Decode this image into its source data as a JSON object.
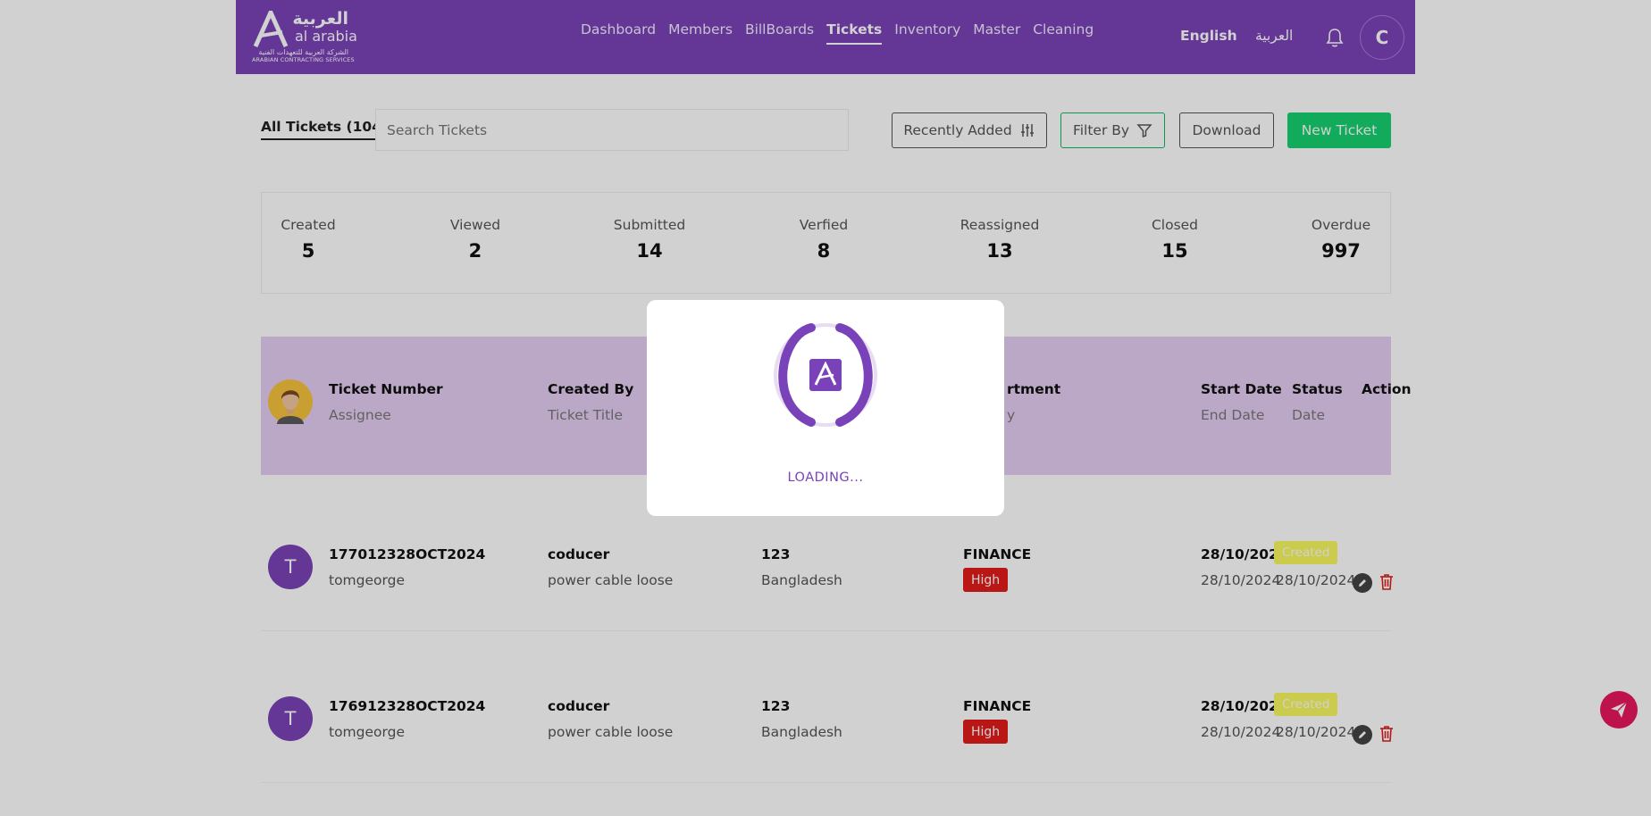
{
  "brand": {
    "arabic_name": "العربية",
    "english_name": "al arabia",
    "arabic_subtitle": "الشركة العربية للتعهدات الفنية",
    "english_subtitle": "ARABIAN CONTRACTING SERVICES"
  },
  "nav": {
    "items": [
      "Dashboard",
      "Members",
      "BillBoards",
      "Tickets",
      "Inventory",
      "Master",
      "Cleaning"
    ],
    "active": "Tickets"
  },
  "header": {
    "lang_en": "English",
    "lang_ar": "العربية",
    "user_initial": "C"
  },
  "toolbar": {
    "all_tickets": "All Tickets (1041)",
    "search_placeholder": "Search Tickets",
    "sort_label": "Recently Added",
    "filter_label": "Filter By",
    "download_label": "Download",
    "new_ticket_label": "New Ticket"
  },
  "stats": [
    {
      "label": "Created",
      "value": "5"
    },
    {
      "label": "Viewed",
      "value": "2"
    },
    {
      "label": "Submitted",
      "value": "14"
    },
    {
      "label": "Verfied",
      "value": "8"
    },
    {
      "label": "Reassigned",
      "value": "13"
    },
    {
      "label": "Closed",
      "value": "15"
    },
    {
      "label": "Overdue",
      "value": "997"
    }
  ],
  "table": {
    "columns": {
      "ticket_number": "Ticket Number",
      "assignee": "Assignee",
      "created_by": "Created By",
      "ticket_title": "Ticket Title",
      "department_partial": "rtment",
      "priority_partial": "y",
      "start_date": "Start Date",
      "end_date": "End Date",
      "status": "Status",
      "date": "Date",
      "action": "Action"
    },
    "rows": [
      {
        "avatar_initial": "T",
        "ticket_number": "177012328OCT2024",
        "assignee": "tomgeorge",
        "created_by": "coducer",
        "title": "power cable loose",
        "code": "123",
        "location": "Bangladesh",
        "department": "FINANCE",
        "priority": "High",
        "start_date": "28/10/2024",
        "end_date": "28/10/2024",
        "status": "Created",
        "status_date": "28/10/2024"
      },
      {
        "avatar_initial": "T",
        "ticket_number": "176912328OCT2024",
        "assignee": "tomgeorge",
        "created_by": "coducer",
        "title": "power cable loose",
        "code": "123",
        "location": "Bangladesh",
        "department": "FINANCE",
        "priority": "High",
        "start_date": "28/10/2024",
        "end_date": "28/10/2024",
        "status": "Created",
        "status_date": "28/10/2024"
      }
    ]
  },
  "loading": {
    "text": "LOADING..."
  },
  "colors": {
    "brand_purple": "#7a42b8",
    "green": "#17d16f",
    "priority_high": "#e21b1b",
    "status_created": "#f8f85e",
    "fab": "#e8175d"
  },
  "icons": [
    "bell-icon",
    "sort-icon",
    "filter-icon",
    "edit-icon",
    "delete-icon",
    "send-icon",
    "logo-icon"
  ]
}
